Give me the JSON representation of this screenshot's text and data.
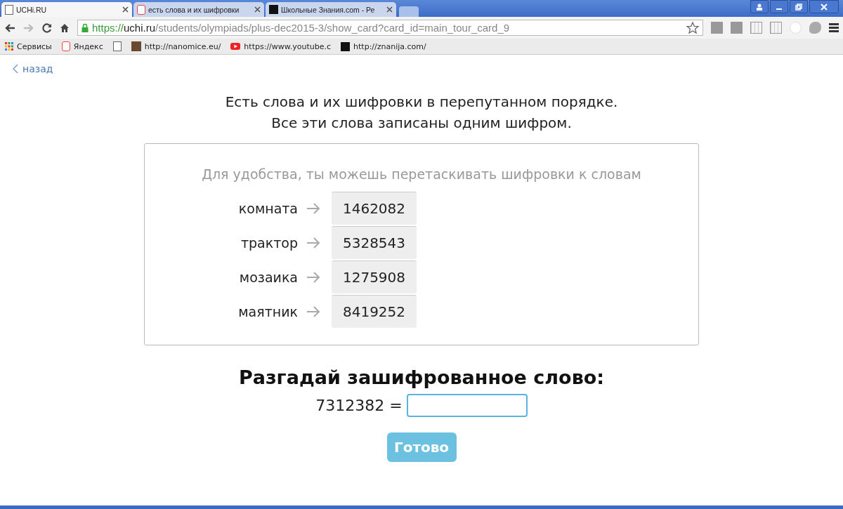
{
  "tabs": [
    {
      "title": "UCHi.RU",
      "selected": true
    },
    {
      "title": "есть слова и их шифровки",
      "selected": false
    },
    {
      "title": "Школьные Знания.com - Ре",
      "selected": false
    }
  ],
  "address": {
    "scheme": "https://",
    "host": "uchi.ru",
    "path": "/students/olympiads/plus-dec2015-3/show_card?card_id=main_tour_card_9"
  },
  "bookmarks": [
    {
      "label": "Сервисы"
    },
    {
      "label": "Яндекс"
    },
    {
      "label": "http://nanomice.eu/"
    },
    {
      "label": "https://www.youtube.c"
    },
    {
      "label": "http://znanija.com/"
    }
  ],
  "back_link": "назад",
  "intro": [
    "Есть слова и их шифровки в перепутанном порядке.",
    "Все эти слова записаны одним шифром."
  ],
  "hint": "Для удобства, ты можешь перетаскивать шифровки к словам",
  "pairs": [
    {
      "word": "комната",
      "code": "1462082"
    },
    {
      "word": "трактор",
      "code": "5328543"
    },
    {
      "word": "мозаика",
      "code": "1275908"
    },
    {
      "word": "маятник",
      "code": "8419252"
    }
  ],
  "question": "Разгадай зашифрованное слово:",
  "equation": "7312382 =",
  "submit": "Готово"
}
